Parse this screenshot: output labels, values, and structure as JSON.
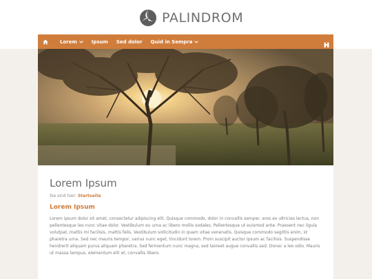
{
  "header": {
    "logo_text": "PALINDROM"
  },
  "nav": {
    "home_icon": "home-icon",
    "items": [
      {
        "label": "Lorem",
        "has_dropdown": true
      },
      {
        "label": "Ipsum",
        "has_dropdown": false
      },
      {
        "label": "Sed dolor",
        "has_dropdown": false
      },
      {
        "label": "Quid in Sempra",
        "has_dropdown": true
      }
    ],
    "search_icon": "search-icon"
  },
  "colors": {
    "accent": "#d07d3c",
    "page_background": "#f3f0ec",
    "text": "#7a7a7a"
  },
  "main": {
    "title": "Lorem Ipsum",
    "breadcrumb_prefix": "Sie sind hier:",
    "breadcrumb_link": "Startseite",
    "section_title": "Lorem Ipsum",
    "body": "Lorem ipsum dolor sit amet, consectetur adipiscing elit. Quisque commodo, dolor in convallis semper, eros ex ultricies lectus, non pellentesque leo nunc vitae dolor. Vestibulum eu urna ac libero mollis sodales. Pellentesque ut euismod ante. Praesent nec ligula volutpat, mattis mi facilisis, mattis felis. Vestibulum sollicitudin in quam vitae venenatis. Quisque commodo sagittis enim, id pharetra urna. Sed nec mauris tempor, varius nunc eget, tincidunt lorem. Proin suscipit auctor ipsum ac facilisis. Suspendisse hendrerit aliquam purus aliquam pharetra. Sed fermentum nunc magna, sed laoreet augue convallis sed. Donec a leo odio. Mauris ut massa tempus, elementum elit et, convallis libero."
  }
}
